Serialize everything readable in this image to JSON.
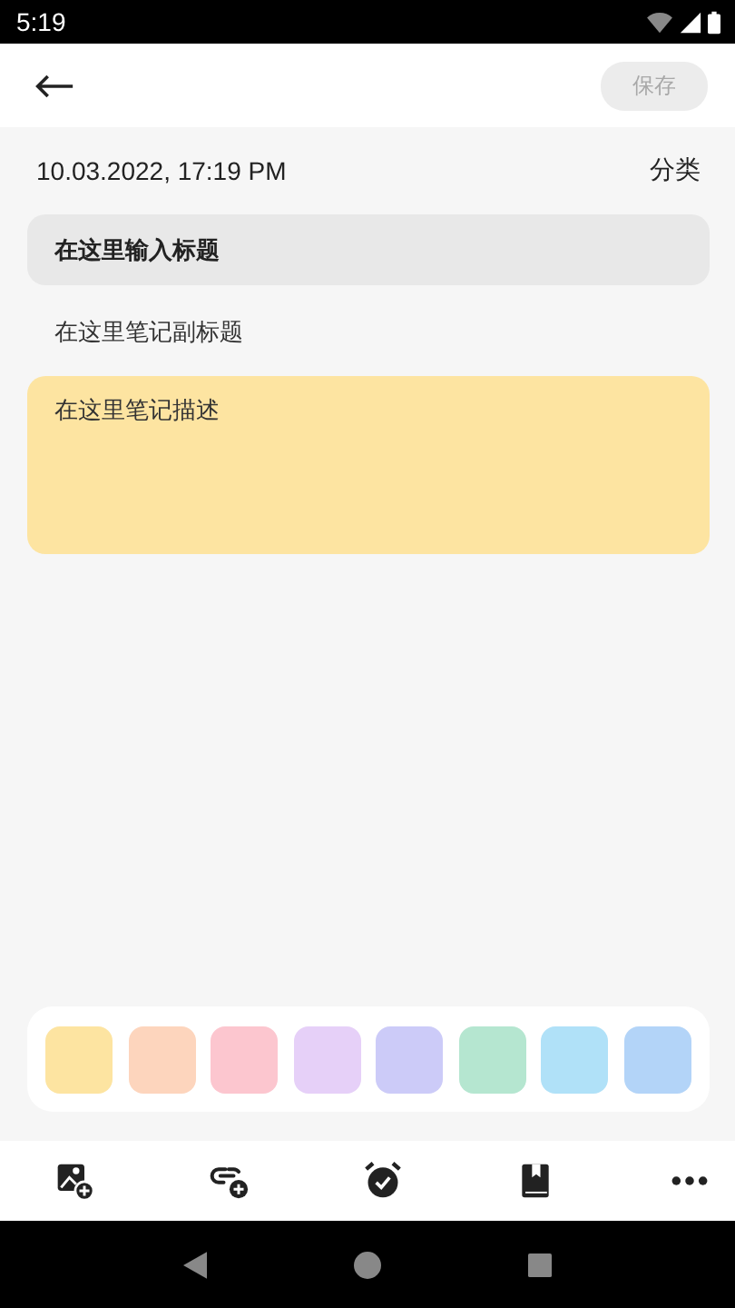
{
  "status_bar": {
    "time": "5:19"
  },
  "header": {
    "save_button": {
      "label": "保存",
      "disabled": true
    }
  },
  "meta": {
    "date": "10.03.2022, 17:19 PM",
    "category": "分类"
  },
  "note": {
    "title": {
      "placeholder": "在这里输入标题"
    },
    "subtitle": {
      "placeholder": "在这里笔记副标题"
    },
    "description": {
      "placeholder": "在这里笔记描述"
    }
  },
  "colors": [
    {
      "color": "#fde4a1"
    },
    {
      "color": "#fdd5bd"
    },
    {
      "color": "#fcc6cf"
    },
    {
      "color": "#e6d0f8"
    },
    {
      "color": "#cccbf8"
    },
    {
      "color": "#b5e6d0"
    },
    {
      "color": "#b0e1f8"
    },
    {
      "color": "#b3d4f8"
    }
  ],
  "toolbar": [
    {
      "kind": "image"
    },
    {
      "kind": "link"
    },
    {
      "kind": "alarm"
    },
    {
      "kind": "book"
    },
    {
      "kind": "more"
    }
  ]
}
